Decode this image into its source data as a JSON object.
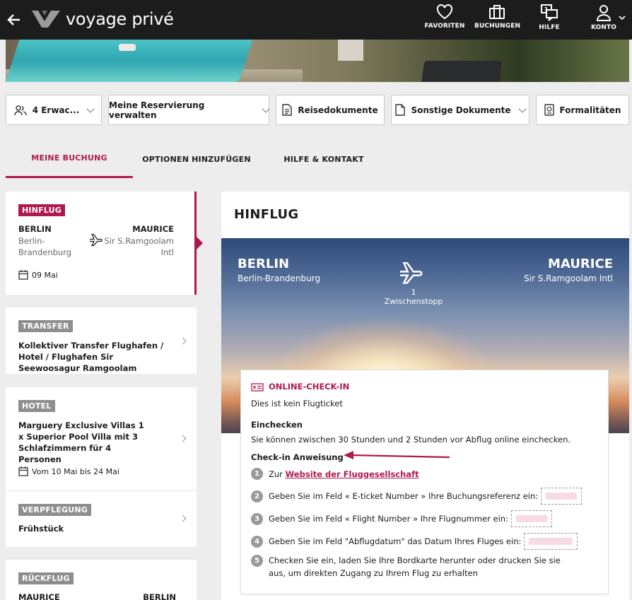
{
  "topbar": {
    "brand": "voyage privé",
    "nav": [
      {
        "label": "FAVORITEN",
        "icon": "heart-icon"
      },
      {
        "label": "BUCHUNGEN",
        "icon": "suitcase-icon"
      },
      {
        "label": "HILFE",
        "icon": "help-chat-icon"
      },
      {
        "label": "KONTO",
        "icon": "user-icon"
      }
    ]
  },
  "actions": {
    "guests": "4 Erwac...",
    "manage": "Meine Reservierung verwalten",
    "travel_docs": "Reisedokumente",
    "other_docs": "Sonstige Dokumente",
    "formalities": "Formalitäten"
  },
  "tabs": [
    "MEINE BUCHUNG",
    "OPTIONEN HINZUFÜGEN",
    "HILFE & KONTAKT"
  ],
  "sidebar": {
    "outbound": {
      "badge": "HINFLUG",
      "from_city": "BERLIN",
      "from_airport": "Berlin-Brandenburg",
      "to_city": "MAURICE",
      "to_airport": "Sir S.Ramgoolam Intl",
      "date": "09 Mai"
    },
    "transfer": {
      "badge": "TRANSFER",
      "title": "Kollektiver Transfer Flughafen / Hotel / Flughafen Sir Seewoosagur Ramgoolam"
    },
    "hotel": {
      "badge": "HOTEL",
      "title": "Marguery Exclusive Villas 1 x Superior Pool Villa mit 3 Schlafzimmern für 4 Personen",
      "dates": "Vom 10 Mai bis 24 Mai"
    },
    "meals": {
      "badge": "VERPFLEGUNG",
      "title": "Frühstück"
    },
    "return": {
      "badge": "RÜCKFLUG",
      "from_city": "MAURICE",
      "to_city": "BERLIN"
    }
  },
  "main": {
    "title": "HINFLUG",
    "from_city": "BERLIN",
    "from_airport": "Berlin-Brandenburg",
    "to_city": "MAURICE",
    "to_airport": "Sir S.Ramgoolam Intl",
    "stops": "1 Zwischenstopp",
    "checkin": {
      "heading": "ONLINE-CHECK-IN",
      "note": "Dies ist kein Flugticket",
      "section1": "Einchecken",
      "section1_text": "Sie können zwischen 30 Stunden und 2 Stunden vor Abflug online einchecken.",
      "section2": "Check-in Anweisung",
      "steps": [
        {
          "num": "1",
          "prefix": "Zur ",
          "link": "Website der Fluggesellschaft"
        },
        {
          "num": "2",
          "text": "Geben Sie im Feld « E-ticket Number » Ihre Buchungsreferenz ein:"
        },
        {
          "num": "3",
          "text": "Geben Sie im Feld « Flight Number » Ihre Flugnummer ein:"
        },
        {
          "num": "4",
          "text": "Geben Sie im Feld \"Abflugdatum\" das Datum Ihres Fluges ein:"
        },
        {
          "num": "5",
          "text": "Checken Sie ein, laden Sie Ihre Bordkarte herunter oder drucken Sie sie aus, um direkten Zugang zu Ihrem Flug zu erhalten"
        }
      ]
    }
  },
  "colors": {
    "accent": "#b01950",
    "topbar": "#1c1c1c",
    "annotation_arrow": "#b01950"
  }
}
